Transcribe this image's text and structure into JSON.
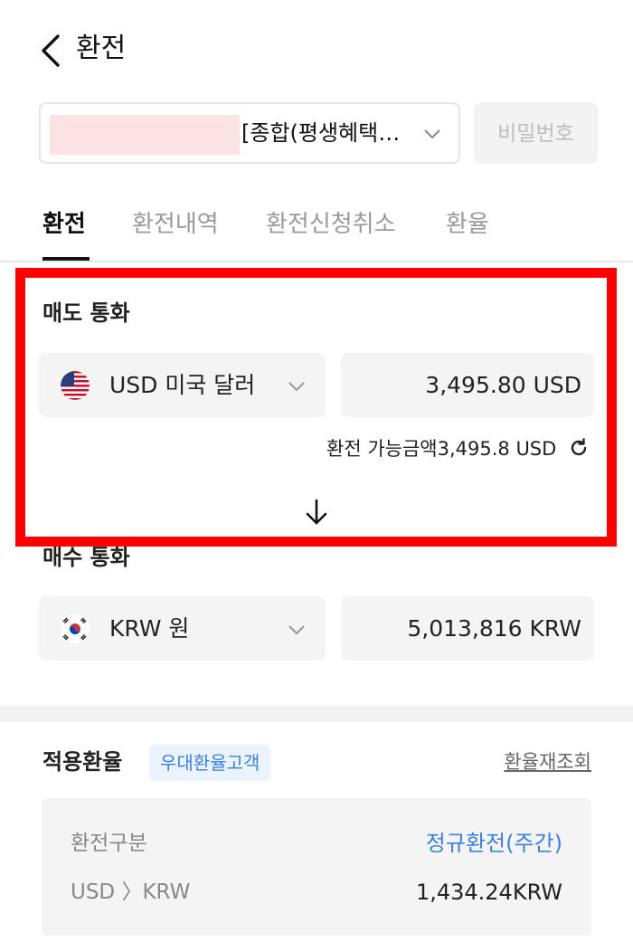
{
  "header": {
    "title": "환전"
  },
  "account": {
    "name": "[종합(평생혜택…",
    "password_label": "비밀번호"
  },
  "tabs": [
    {
      "label": "환전",
      "active": true
    },
    {
      "label": "환전내역",
      "active": false
    },
    {
      "label": "환전신청취소",
      "active": false
    },
    {
      "label": "환율",
      "active": false
    }
  ],
  "sell": {
    "label": "매도 통화",
    "currency": "USD 미국 달러",
    "amount": "3,495.80 USD",
    "available": "환전 가능금액3,495.8 USD"
  },
  "buy": {
    "label": "매수 통화",
    "currency": "KRW 원",
    "amount": "5,013,816 KRW"
  },
  "rate": {
    "title": "적용환율",
    "badge": "우대환율고객",
    "refresh_label": "환율재조회",
    "type_label": "환전구분",
    "type_value": "정규환전(주간)",
    "pair_label": "USD 〉KRW",
    "pair_value": "1,434.24KRW"
  },
  "colors": {
    "highlight_box": "#ff0000",
    "accent_blue": "#3d7fe0"
  },
  "icons": [
    "back-icon",
    "chevron-down-icon",
    "us-flag-icon",
    "kr-flag-icon",
    "refresh-icon",
    "arrow-down-icon"
  ]
}
